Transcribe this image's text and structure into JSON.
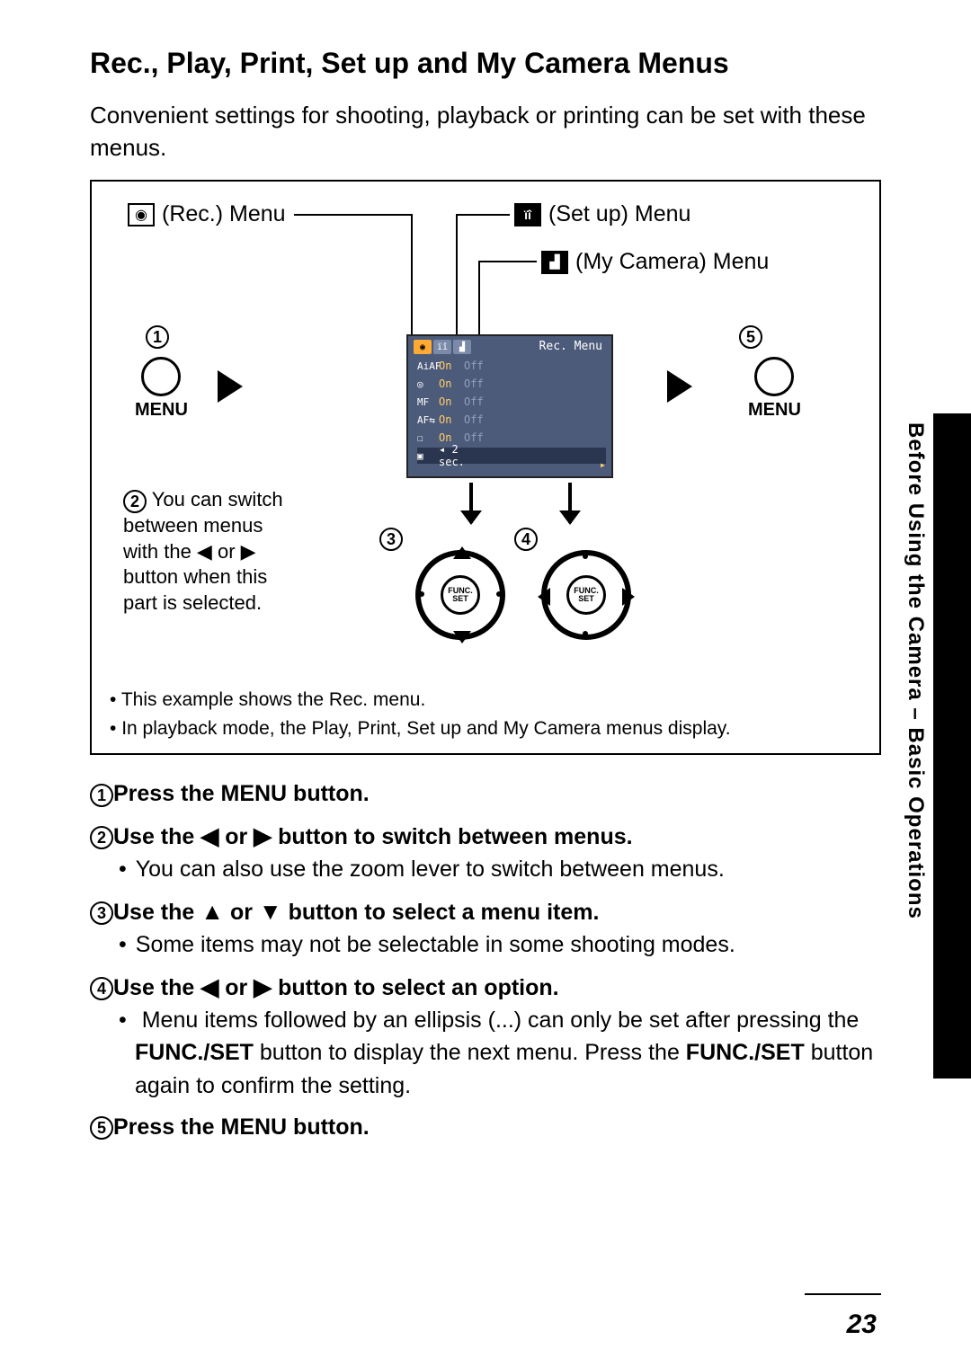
{
  "title": "Rec., Play, Print, Set up and My Camera Menus",
  "intro": "Convenient settings for shooting, playback or printing can be set with these menus.",
  "side_tab_text": "Before Using the Camera – Basic Operations",
  "page_number": "23",
  "figure": {
    "labels": {
      "rec_menu": "(Rec.) Menu",
      "setup_menu": "(Set up) Menu",
      "mycam_menu": "(My Camera) Menu",
      "menu_btn": "MENU"
    },
    "lcd": {
      "title": "Rec. Menu",
      "rows": [
        {
          "icon": "AiAF",
          "on": "On",
          "off": "Off"
        },
        {
          "icon": "◎",
          "on": "On",
          "off": "Off"
        },
        {
          "icon": "MF",
          "on": "On",
          "off": "Off"
        },
        {
          "icon": "AF⇆",
          "on": "On",
          "off": "Off"
        },
        {
          "icon": "☐",
          "on": "On",
          "off": "Off"
        },
        {
          "icon": "▣",
          "on": "◂ 2 sec.",
          "off": ""
        }
      ]
    },
    "note2_lines": [
      "You can switch",
      "between menus",
      "with the  ◀  or  ▶",
      "button when this",
      "part is selected."
    ],
    "footer_notes": [
      "This example shows the Rec. menu.",
      "In playback mode, the Play, Print, Set up and My Camera menus display."
    ],
    "func_label": "FUNC.\nSET"
  },
  "steps": {
    "s1": "Press the MENU button.",
    "s2_a": "Use the  ",
    "s2_b": "  or  ",
    "s2_c": "  button to switch between menus.",
    "s2_sub": "You can also use the zoom lever to switch between menus.",
    "s3_a": "Use the  ",
    "s3_b": "  or  ",
    "s3_c": "  button to select a menu item.",
    "s3_sub": "Some items may not be selectable in some shooting modes.",
    "s4_a": "Use the  ",
    "s4_b": "  or  ",
    "s4_c": "  button to select an option.",
    "s4_sub_a": "Menu items followed by an ellipsis (...) can only be set after pressing the ",
    "s4_sub_b": " button to display the next menu. Press the ",
    "s4_sub_c": " button again to confirm the setting.",
    "func_set": "FUNC./SET",
    "s5": "Press the MENU button."
  }
}
